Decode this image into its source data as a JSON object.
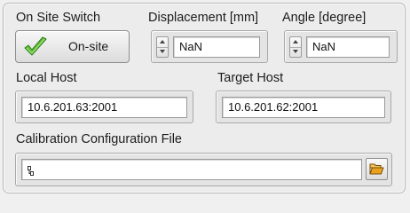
{
  "on_site_switch": {
    "label": "On Site Switch",
    "button_label": "On-site",
    "icon": "checkmark-icon"
  },
  "displacement": {
    "label": "Displacement [mm]",
    "value": "NaN"
  },
  "angle": {
    "label": "Angle [degree]",
    "value": "NaN"
  },
  "local_host": {
    "label": "Local Host",
    "value": "10.6.201.63:2001"
  },
  "target_host": {
    "label": "Target Host",
    "value": "10.6.201.62:2001"
  },
  "calibration_file": {
    "label": "Calibration Configuration File",
    "value": "",
    "path_icon": "path-icon",
    "browse_icon": "folder-open-icon"
  },
  "colors": {
    "check_green": "#4caf2a",
    "folder_orange": "#e09a1a"
  }
}
